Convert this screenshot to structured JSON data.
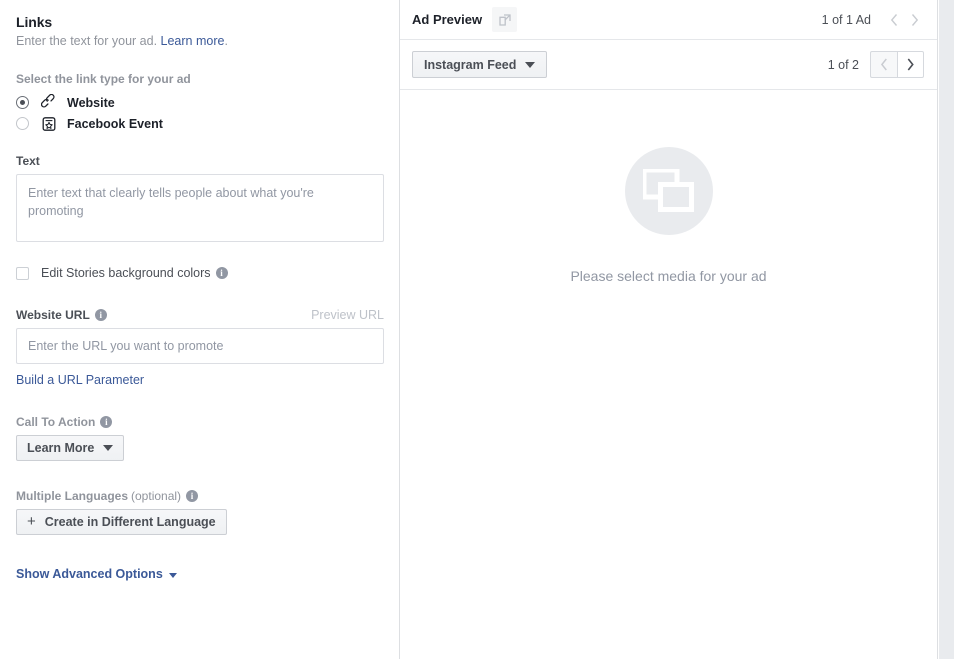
{
  "left": {
    "title": "Links",
    "subtitle_before": "Enter the text for your ad.",
    "learn_more": "Learn more",
    "subtitle_after": ".",
    "link_type_label": "Select the link type for your ad",
    "link_types": [
      {
        "label": "Website",
        "icon": "chain-link-icon",
        "selected": true
      },
      {
        "label": "Facebook Event",
        "icon": "event-star-icon",
        "selected": false
      }
    ],
    "text_label": "Text",
    "text_placeholder": "Enter text that clearly tells people about what you're promoting",
    "text_value": "",
    "stories_checkbox_label": "Edit Stories background colors",
    "stories_checked": false,
    "website_url_label": "Website URL",
    "preview_url_label": "Preview URL",
    "url_placeholder": "Enter the URL you want to promote",
    "url_value": "",
    "build_url_param": "Build a URL Parameter",
    "cta_label": "Call To Action",
    "cta_value": "Learn More",
    "languages_label": "Multiple Languages",
    "languages_optional": "(optional)",
    "create_language_button": "Create in Different Language",
    "advanced_options": "Show Advanced Options",
    "info_glyph": "i"
  },
  "right": {
    "preview_title": "Ad Preview",
    "open_external_icon": "open-in-new-window-icon",
    "ad_count": "1 of 1 Ad",
    "prev_arrow": "‹",
    "next_arrow": "›",
    "placement_value": "Instagram Feed",
    "placement_count": "1 of 2",
    "placement_prev": "‹",
    "placement_next": "›",
    "empty_state_text": "Please select media for your ad",
    "empty_state_icon": "media-placeholder-icon"
  },
  "colors": {
    "link_blue": "#3b5998",
    "text_dark": "#1d2129",
    "text_gray": "#90949c",
    "border": "#dddfe2",
    "placeholder_bg": "#e9ebee"
  }
}
